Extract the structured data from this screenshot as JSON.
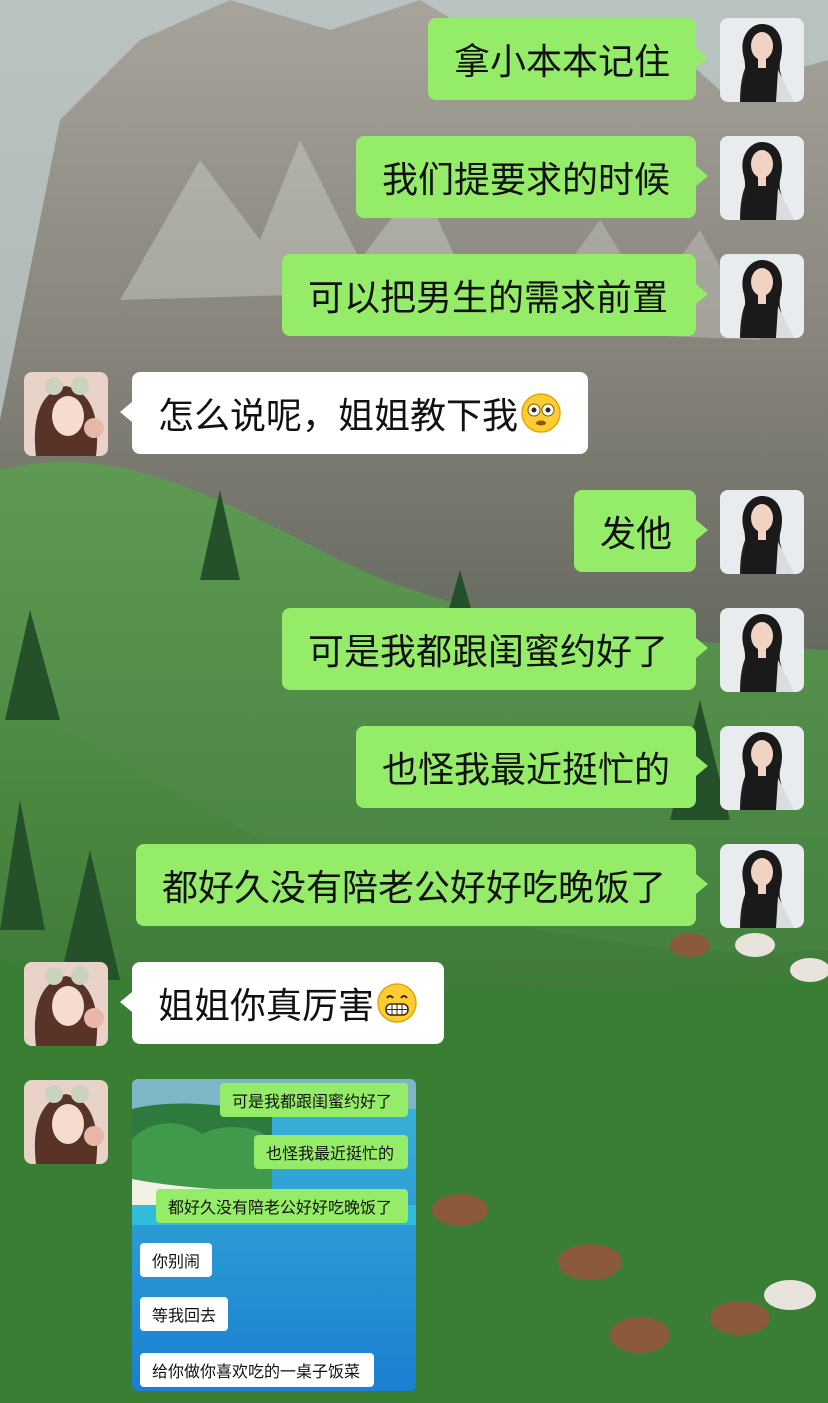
{
  "colors": {
    "my_bubble": "#95ec69",
    "their_bubble": "#ffffff",
    "grass": "#3f8a3a",
    "mountain": "#8b8f89"
  },
  "messages": [
    {
      "sender": "me",
      "text": "拿小本本记住"
    },
    {
      "sender": "me",
      "text": "我们提要求的时候"
    },
    {
      "sender": "me",
      "text": "可以把男生的需求前置"
    },
    {
      "sender": "them",
      "text": "怎么说呢，姐姐教下我",
      "emoji": "flushed-face-icon"
    },
    {
      "sender": "me",
      "text": "发他"
    },
    {
      "sender": "me",
      "text": "可是我都跟闺蜜约好了"
    },
    {
      "sender": "me",
      "text": "也怪我最近挺忙的"
    },
    {
      "sender": "me",
      "text": "都好久没有陪老公好好吃晚饭了"
    },
    {
      "sender": "them",
      "text": "姐姐你真厉害",
      "emoji": "grinning-face-icon"
    },
    {
      "sender": "them",
      "type": "image"
    }
  ],
  "shared_screenshot": {
    "messages": [
      {
        "sender": "me",
        "text": "可是我都跟闺蜜约好了"
      },
      {
        "sender": "me",
        "text": "也怪我最近挺忙的"
      },
      {
        "sender": "me",
        "text": "都好久没有陪老公好好吃晚饭了"
      },
      {
        "sender": "them",
        "text": "你别闹"
      },
      {
        "sender": "them",
        "text": "等我回去"
      },
      {
        "sender": "them",
        "text": "给你做你喜欢吃的一桌子饭菜"
      }
    ]
  }
}
